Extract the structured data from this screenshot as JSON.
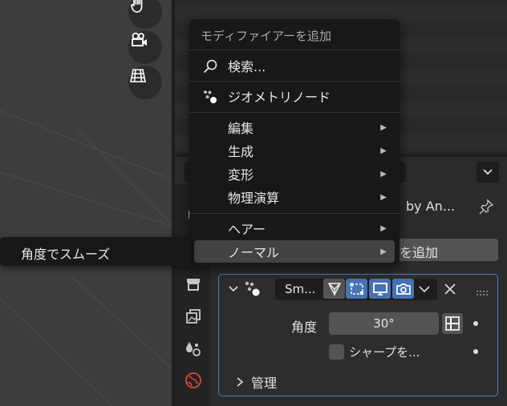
{
  "menu": {
    "title": "モディファイアーを追加",
    "search_label": "検索...",
    "geometry_nodes_label": "ジオメトリノード",
    "categories": [
      {
        "label": "編集"
      },
      {
        "label": "生成"
      },
      {
        "label": "変形"
      },
      {
        "label": "物理演算"
      }
    ],
    "extra": [
      {
        "label": "ヘアー"
      },
      {
        "label": "ノーマル"
      }
    ]
  },
  "submenu": {
    "items": [
      {
        "label": "角度でスムーズ"
      }
    ]
  },
  "properties": {
    "object_name_partial": "by An...",
    "add_modifier_partial": "を追加"
  },
  "modifier": {
    "name": "Sm...",
    "angle_label": "角度",
    "angle_value": "30°",
    "sharp_label": "シャープを...",
    "sharp_checked": false,
    "manage_label": "管理"
  },
  "colors": {
    "accent_blue": "#4772b3",
    "panel_border": "#4f7fc7",
    "menu_bg": "#181818",
    "globe_red": "#e0463a"
  }
}
